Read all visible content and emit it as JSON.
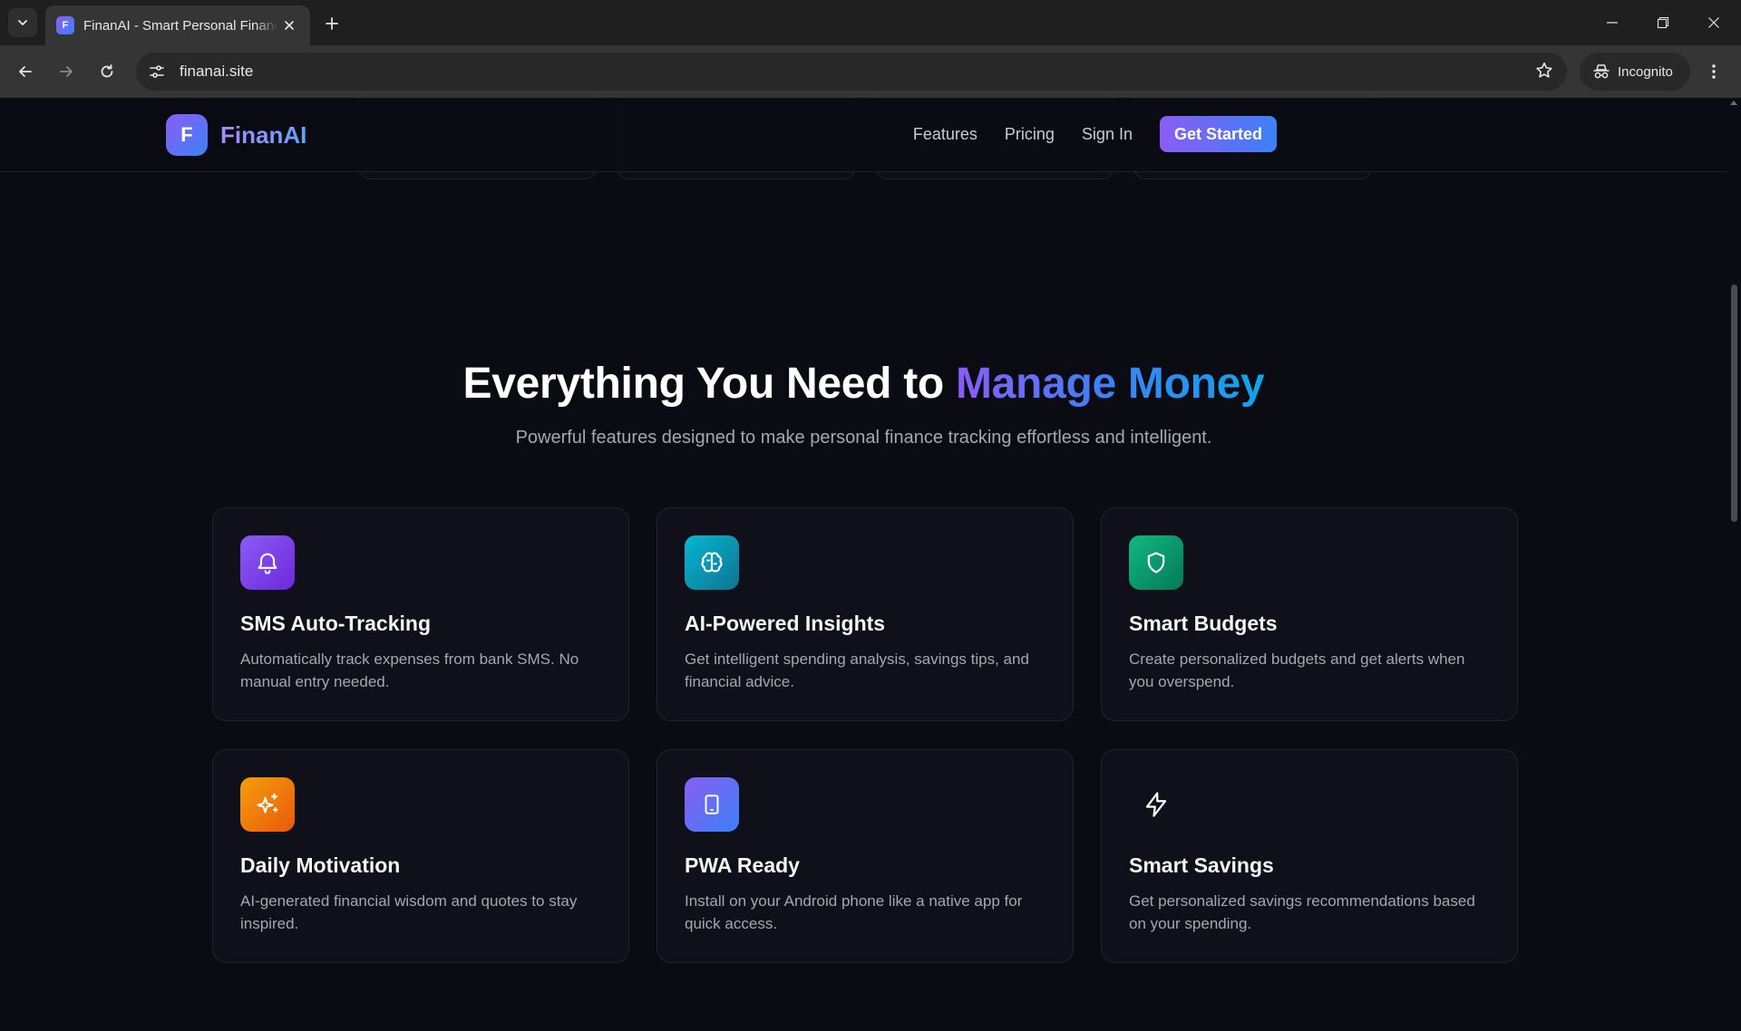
{
  "browser": {
    "tab_title": "FinanAI - Smart Personal Finance",
    "tab_favicon_letter": "F",
    "url": "finanai.site",
    "incognito_label": "Incognito"
  },
  "site": {
    "logo_letter": "F",
    "brand_name": "FinanAI",
    "nav": {
      "features": "Features",
      "pricing": "Pricing",
      "sign_in": "Sign In",
      "get_started": "Get Started"
    }
  },
  "hero": {
    "title_plain": "Everything You Need to ",
    "title_highlight": "Manage Money",
    "subtitle": "Powerful features designed to make personal finance tracking effortless and intelligent."
  },
  "features": [
    {
      "title": "SMS Auto-Tracking",
      "description": "Automatically track expenses from bank SMS. No manual entry needed.",
      "icon": "bell-icon",
      "color": "#7c3aed"
    },
    {
      "title": "AI-Powered Insights",
      "description": "Get intelligent spending analysis, savings tips, and financial advice.",
      "icon": "brain-icon",
      "color": "#0891b2"
    },
    {
      "title": "Smart Budgets",
      "description": "Create personalized budgets and get alerts when you overspend.",
      "icon": "shield-icon",
      "color": "#059669"
    },
    {
      "title": "Daily Motivation",
      "description": "AI-generated financial wisdom and quotes to stay inspired.",
      "icon": "sparkles-icon",
      "color": "#f59e0b"
    },
    {
      "title": "PWA Ready",
      "description": "Install on your Android phone like a native app for quick access.",
      "icon": "tablet-icon",
      "color": "#6366f1"
    },
    {
      "title": "Smart Savings",
      "description": "Get personalized savings recommendations based on your spending.",
      "icon": "lightning-icon",
      "color": "#10101a"
    }
  ]
}
